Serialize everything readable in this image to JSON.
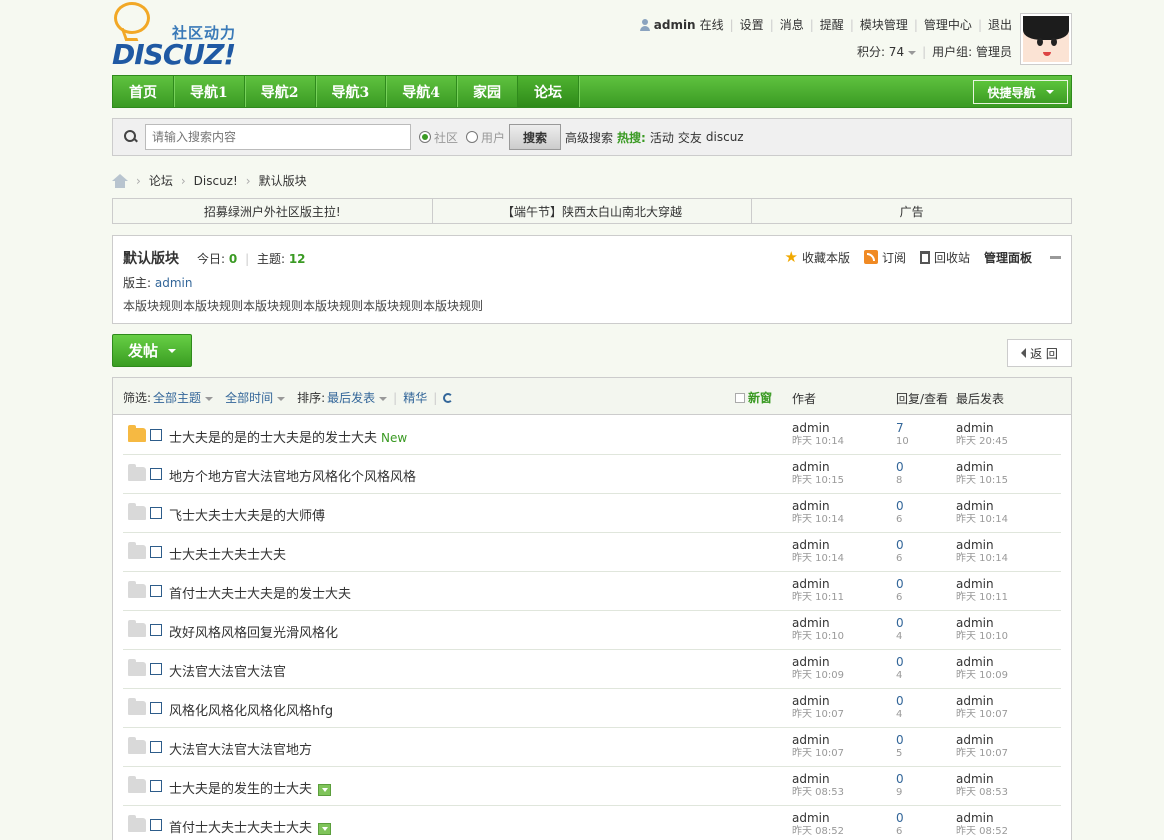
{
  "logo": {
    "cn": "社区动力",
    "en": "DISCUZ!"
  },
  "user": {
    "name": "admin",
    "status": "在线",
    "links": [
      "设置",
      "消息",
      "提醒",
      "模块管理",
      "管理中心",
      "退出"
    ],
    "credits_label": "积分: 74",
    "group_label": "用户组: 管理员"
  },
  "nav": {
    "items": [
      "首页",
      "导航1",
      "导航2",
      "导航3",
      "导航4",
      "家园",
      "论坛"
    ],
    "active": "论坛",
    "quick_nav": "快捷导航"
  },
  "search": {
    "placeholder": "请输入搜索内容",
    "scope_options": [
      "社区",
      "用户"
    ],
    "scope_selected": "社区",
    "button": "搜索",
    "advanced": "高级搜索",
    "hot_label": "热搜:",
    "hot_terms": [
      "活动",
      "交友",
      "discuz"
    ]
  },
  "breadcrumb": [
    "论坛",
    "Discuz!",
    "默认版块"
  ],
  "announcements": [
    "招募绿洲户外社区版主拉!",
    "【端午节】陕西太白山南北大穿越",
    "广告"
  ],
  "forum": {
    "title": "默认版块",
    "today_label": "今日:",
    "today": "0",
    "threads_label": "主题:",
    "threads": "12",
    "moderator_label": "版主:",
    "moderator": "admin",
    "rules": "本版块规则本版块规则本版块规则本版块规则本版块规则本版块规则",
    "actions": {
      "favorite": "收藏本版",
      "subscribe": "订阅",
      "recycle": "回收站",
      "manage": "管理面板"
    }
  },
  "buttons": {
    "post": "发帖",
    "back": "返 回"
  },
  "list_header": {
    "filter_label": "筛选:",
    "all_threads": "全部主题",
    "all_time": "全部时间",
    "sort_label": "排序:",
    "sort_value": "最后发表",
    "digest": "精华",
    "new_window": "新窗",
    "author": "作者",
    "replies_views": "回复/查看",
    "last_post": "最后发表"
  },
  "threads": [
    {
      "title": "士大夫是的是的士大夫是的发士大夫",
      "is_new": true,
      "new_label": "New",
      "attachment": false,
      "author": "admin",
      "author_time": "昨天 10:14",
      "replies": "7",
      "views": "10",
      "last_user": "admin",
      "last_time": "昨天 20:45"
    },
    {
      "title": "地方个地方官大法官地方风格化个风格风格",
      "is_new": false,
      "attachment": false,
      "author": "admin",
      "author_time": "昨天 10:15",
      "replies": "0",
      "views": "8",
      "last_user": "admin",
      "last_time": "昨天 10:15"
    },
    {
      "title": "飞士大夫士大夫是的大师傅",
      "is_new": false,
      "attachment": false,
      "author": "admin",
      "author_time": "昨天 10:14",
      "replies": "0",
      "views": "6",
      "last_user": "admin",
      "last_time": "昨天 10:14"
    },
    {
      "title": "士大夫士大夫士大夫",
      "is_new": false,
      "attachment": false,
      "author": "admin",
      "author_time": "昨天 10:14",
      "replies": "0",
      "views": "6",
      "last_user": "admin",
      "last_time": "昨天 10:14"
    },
    {
      "title": "首付士大夫士大夫是的发士大夫",
      "is_new": false,
      "attachment": false,
      "author": "admin",
      "author_time": "昨天 10:11",
      "replies": "0",
      "views": "6",
      "last_user": "admin",
      "last_time": "昨天 10:11"
    },
    {
      "title": "改好风格风格回复光滑风格化",
      "is_new": false,
      "attachment": false,
      "author": "admin",
      "author_time": "昨天 10:10",
      "replies": "0",
      "views": "4",
      "last_user": "admin",
      "last_time": "昨天 10:10"
    },
    {
      "title": "大法官大法官大法官",
      "is_new": false,
      "attachment": false,
      "author": "admin",
      "author_time": "昨天 10:09",
      "replies": "0",
      "views": "4",
      "last_user": "admin",
      "last_time": "昨天 10:09"
    },
    {
      "title": "风格化风格化风格化风格hfg",
      "is_new": false,
      "attachment": false,
      "author": "admin",
      "author_time": "昨天 10:07",
      "replies": "0",
      "views": "4",
      "last_user": "admin",
      "last_time": "昨天 10:07"
    },
    {
      "title": "大法官大法官大法官地方",
      "is_new": false,
      "attachment": false,
      "author": "admin",
      "author_time": "昨天 10:07",
      "replies": "0",
      "views": "5",
      "last_user": "admin",
      "last_time": "昨天 10:07"
    },
    {
      "title": "士大夫是的发生的士大夫",
      "is_new": false,
      "attachment": true,
      "author": "admin",
      "author_time": "昨天 08:53",
      "replies": "0",
      "views": "9",
      "last_user": "admin",
      "last_time": "昨天 08:53"
    },
    {
      "title": "首付士大夫士大夫士大夫",
      "is_new": false,
      "attachment": true,
      "author": "admin",
      "author_time": "昨天 08:52",
      "replies": "0",
      "views": "6",
      "last_user": "admin",
      "last_time": "昨天 08:52"
    }
  ]
}
